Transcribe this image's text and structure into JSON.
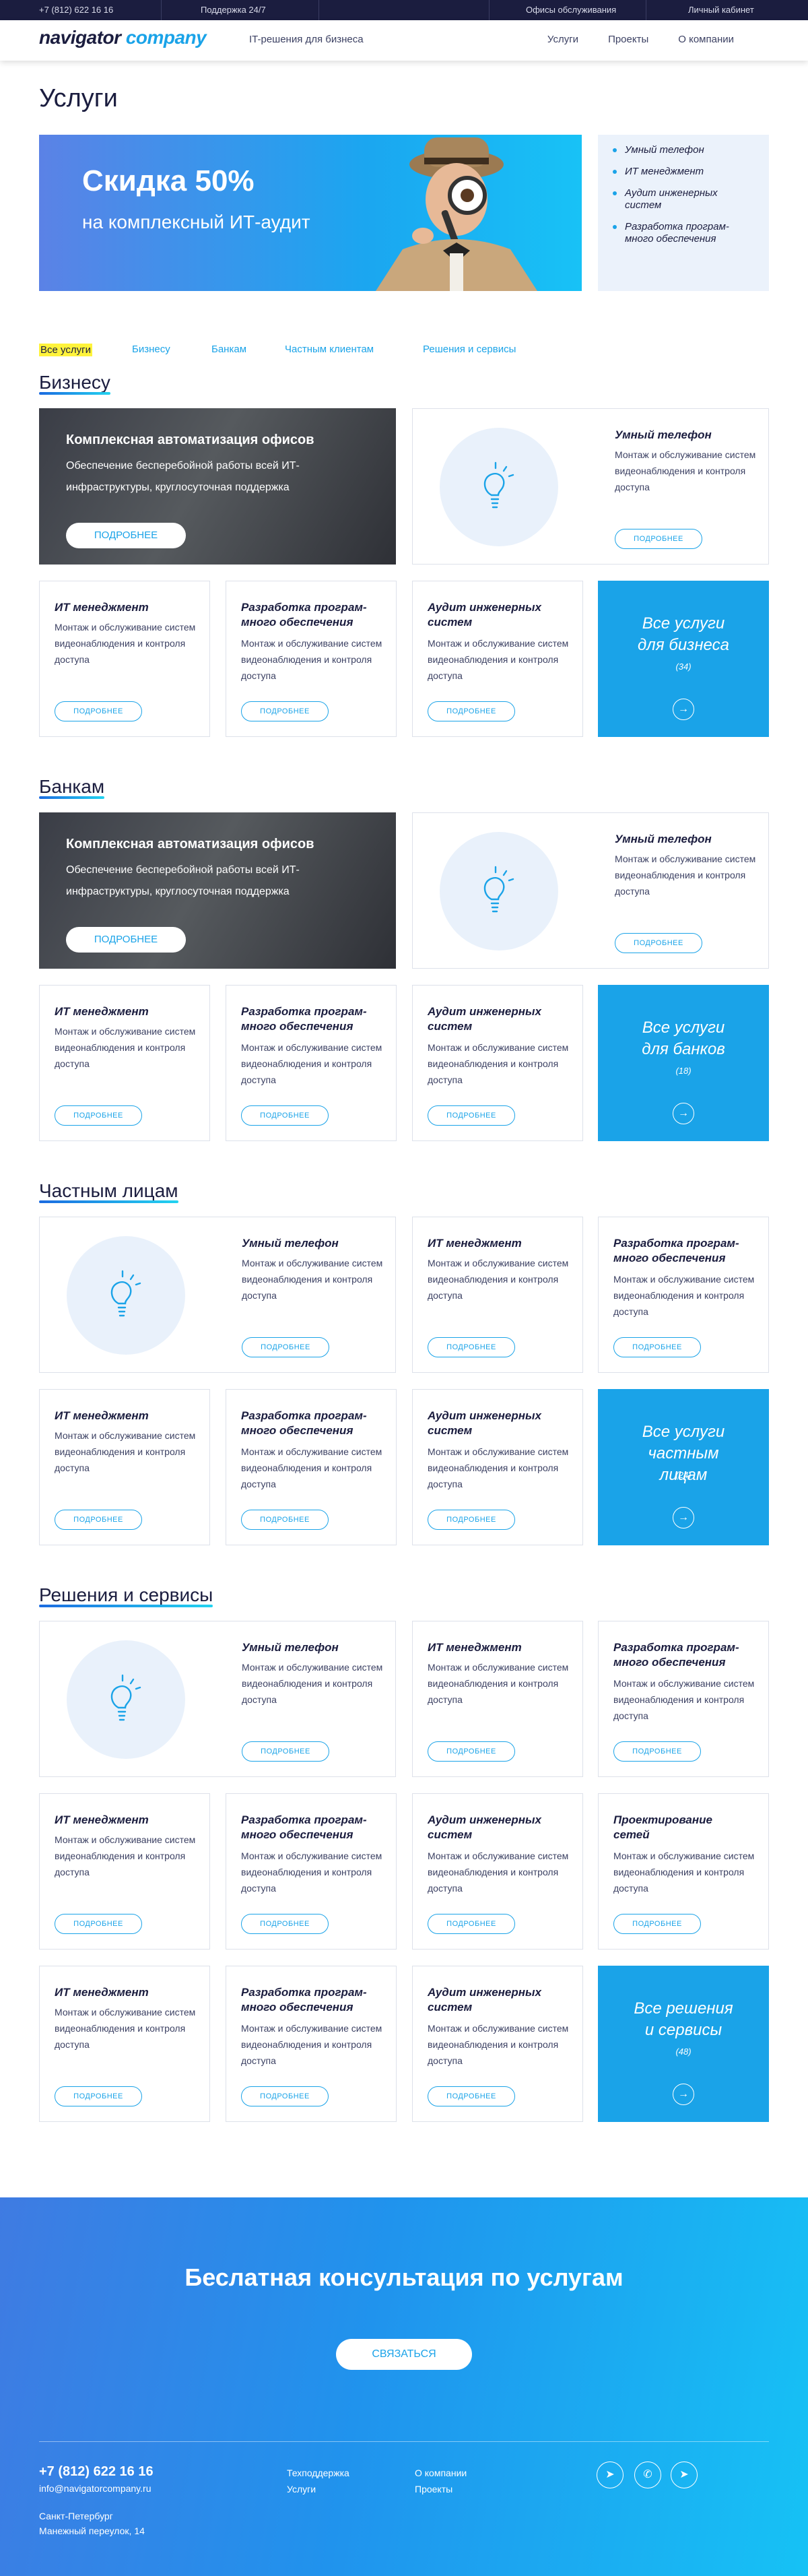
{
  "topbar": {
    "phone": "+7 (812) 622 16 16",
    "support": "Поддержка 24/7",
    "offices": "Офисы обслуживания",
    "cabinet": "Личный кабинет"
  },
  "header": {
    "logo_a": "navigator",
    "logo_b": "company",
    "tagline": "IT-решения для бизнеса",
    "nav": [
      "Услуги",
      "Проекты",
      "О компании"
    ]
  },
  "page_title": "Услуги",
  "hero": {
    "headline": "Скидка 50%",
    "subline": "на комплексный ИТ-аудит",
    "list": [
      "Умный телефон",
      "ИТ менеджмент",
      "Аудит инженерных систем",
      "Разработка програм-много обеспечения"
    ]
  },
  "filters": [
    "Все услуги",
    "Бизнесу",
    "Банкам",
    "Частным клиентам",
    "Решения и сервисы"
  ],
  "common": {
    "dark_title": "Комплексная автоматизация офисов",
    "dark_desc": "Обеспечение бесперебойной работы всей ИТ-инфраструктуры, круглосуточная поддержка",
    "dark_btn": "ПОДРОБНЕЕ",
    "desc": "Монтаж и обслуживание систем видеонаблюдения и контроля доступа",
    "more": "ПОДРОБНЕЕ",
    "t_phone": "Умный телефон",
    "t_it": "ИТ менеджмент",
    "t_dev": "Разработка програм-много обеспечения",
    "t_audit": "Аудит инженерных систем",
    "t_net": "Проектирование сетей"
  },
  "sections": {
    "business": {
      "title": "Бизнесу",
      "all": "Все услуги для бизнеса",
      "count": "(34)"
    },
    "banks": {
      "title": "Банкам",
      "all": "Все услуги для банков",
      "count": "(18)"
    },
    "private": {
      "title": "Частным лицам",
      "all": "Все услуги частным лицам",
      "count": "(24)"
    },
    "solutions": {
      "title": "Решения и сервисы",
      "all": "Все решения и сервисы",
      "count": "(48)"
    }
  },
  "cta": {
    "title": "Беслатная консультация по услугам",
    "button": "СВЯЗАТЬСЯ",
    "phone": "+7 (812) 622 16 16",
    "email": "info@navigatorcompany.ru",
    "city": "Санкт-Петербург",
    "address": "Манежный переулок, 14",
    "links": [
      "Техподдержка",
      "Услуги",
      "О компании",
      "Проекты"
    ]
  },
  "icons": {
    "telegram": "telegram-icon",
    "whatsapp": "whatsapp-icon",
    "arrow": "arrow-right-icon",
    "bulb": "lightbulb-icon"
  }
}
